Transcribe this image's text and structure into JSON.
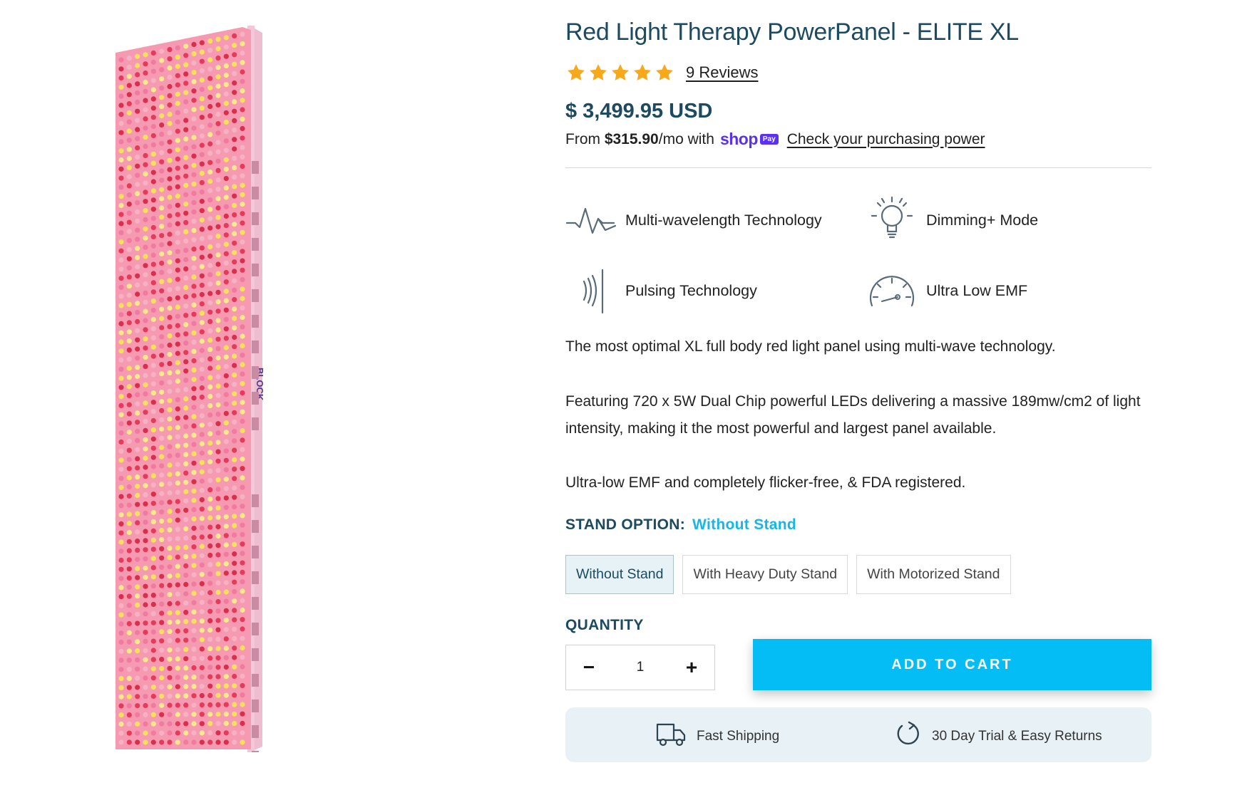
{
  "product": {
    "title": "Red Light Therapy PowerPanel - ELITE XL",
    "rating_stars": 5,
    "reviews_link": "9 Reviews",
    "price": "$ 3,499.95 USD",
    "installment_prefix": "From ",
    "installment_amount": "$315.90",
    "installment_suffix": "/mo with",
    "shop_word": "shop",
    "pay_badge": "Pay",
    "purchasing_link": "Check your purchasing power",
    "brand_mark": "BLOCK"
  },
  "features": [
    {
      "label": "Multi-wavelength Technology",
      "icon": "waveform-icon"
    },
    {
      "label": "Dimming+ Mode",
      "icon": "lightbulb-icon"
    },
    {
      "label": "Pulsing Technology",
      "icon": "pulse-waves-icon"
    },
    {
      "label": "Ultra Low EMF",
      "icon": "gauge-icon"
    }
  ],
  "description": [
    "The most optimal XL full body red light panel using multi-wave technology.",
    "Featuring 720 x 5W Dual Chip powerful LEDs delivering a massive 189mw/cm2 of light intensity, making it the most powerful and largest panel available.",
    "Ultra-low EMF and completely flicker-free, & FDA registered."
  ],
  "stand": {
    "label": "STAND OPTION:",
    "selected": "Without Stand",
    "options": [
      "Without Stand",
      "With Heavy Duty Stand",
      "With Motorized Stand"
    ]
  },
  "quantity": {
    "label": "QUANTITY",
    "minus": "−",
    "value": "1",
    "plus": "+"
  },
  "cart": {
    "button": "ADD TO CART"
  },
  "perks": [
    {
      "label": "Fast Shipping",
      "icon": "truck-icon"
    },
    {
      "label": "30 Day Trial & Easy Returns",
      "icon": "return-arrow-icon"
    }
  ],
  "colors": {
    "heading": "#1c4a60",
    "accent": "#04bdf4",
    "selected_text": "#17b6e8",
    "star": "#f7a81b",
    "shop_pay": "#5a31f4",
    "panel_pink": "#f48fa8"
  }
}
